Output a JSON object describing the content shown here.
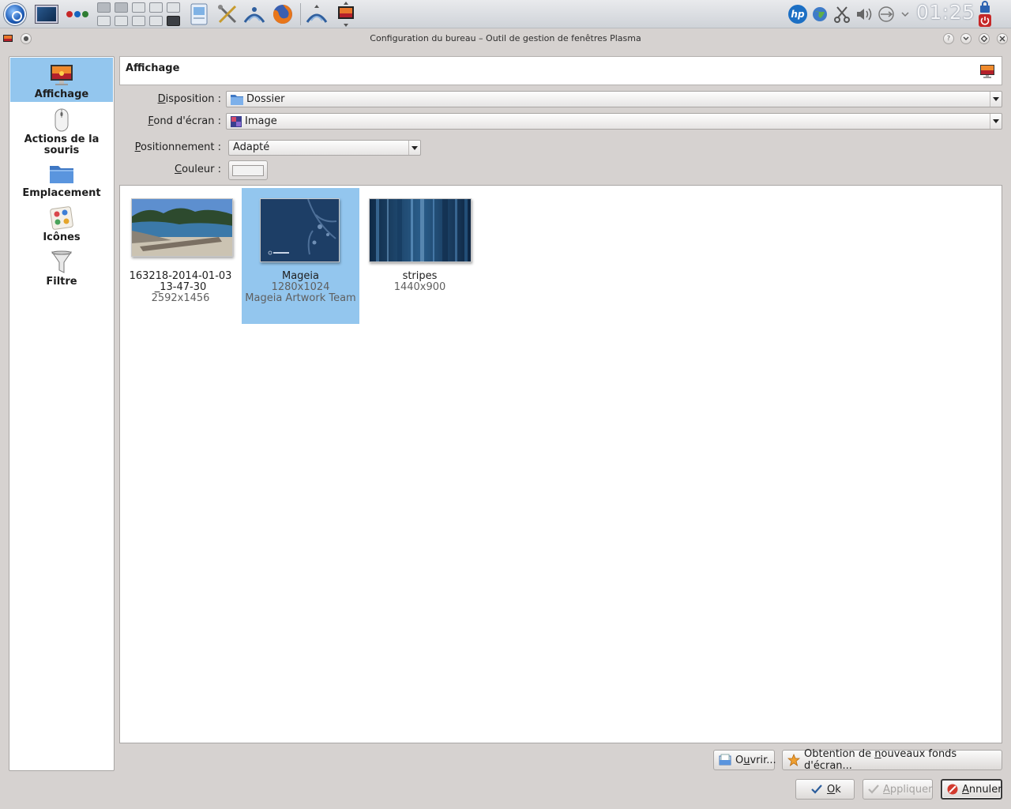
{
  "panel": {
    "clock": "01:25"
  },
  "window": {
    "title": "Configuration du bureau – Outil de gestion de fenêtres Plasma"
  },
  "sidebar": {
    "items": [
      {
        "label": "Affichage",
        "icon": "monitor-sunset-icon",
        "selected": true
      },
      {
        "label": "Actions de la souris",
        "icon": "mouse-icon",
        "selected": false
      },
      {
        "label": "Emplacement",
        "icon": "folder-icon",
        "selected": false
      },
      {
        "label": "Icônes",
        "icon": "icons-palette-icon",
        "selected": false
      },
      {
        "label": "Filtre",
        "icon": "funnel-icon",
        "selected": false
      }
    ]
  },
  "header": {
    "title": "Affichage"
  },
  "form": {
    "disposition": {
      "label_mnemonic": "D",
      "label_rest": "isposition :",
      "value": "Dossier"
    },
    "fond": {
      "label_mnemonic": "F",
      "label_rest": "ond d'écran :",
      "value": "Image"
    },
    "positionnement": {
      "label_mnemonic": "P",
      "label_rest": "ositionnement :",
      "value": "Adapté"
    },
    "couleur": {
      "label_mnemonic": "C",
      "label_rest": "ouleur :",
      "swatch": "#f2f2f2"
    }
  },
  "wallpapers": [
    {
      "name": "163218-2014-01-03 _13-47-30",
      "info": "2592x1456",
      "selected": false
    },
    {
      "name": "Mageia",
      "info": "1280x1024",
      "author": "Mageia Artwork Team",
      "selected": true
    },
    {
      "name": "stripes",
      "info": "1440x900",
      "selected": false
    }
  ],
  "buttons": {
    "ouvrir": {
      "pre": "O",
      "mnemonic": "u",
      "post": "vrir..."
    },
    "getnew": {
      "pre": "Obtention de ",
      "mnemonic": "n",
      "post": "ouveaux fonds d'écran..."
    },
    "ok": {
      "pre": "",
      "mnemonic": "O",
      "post": "k"
    },
    "appliquer": {
      "pre": "",
      "mnemonic": "A",
      "post": "ppliquer"
    },
    "annuler": {
      "pre": "",
      "mnemonic": "A",
      "post": "nnuler"
    }
  },
  "colors": {
    "selection": "#93c6ee",
    "window_bg": "#d6d2d0"
  }
}
